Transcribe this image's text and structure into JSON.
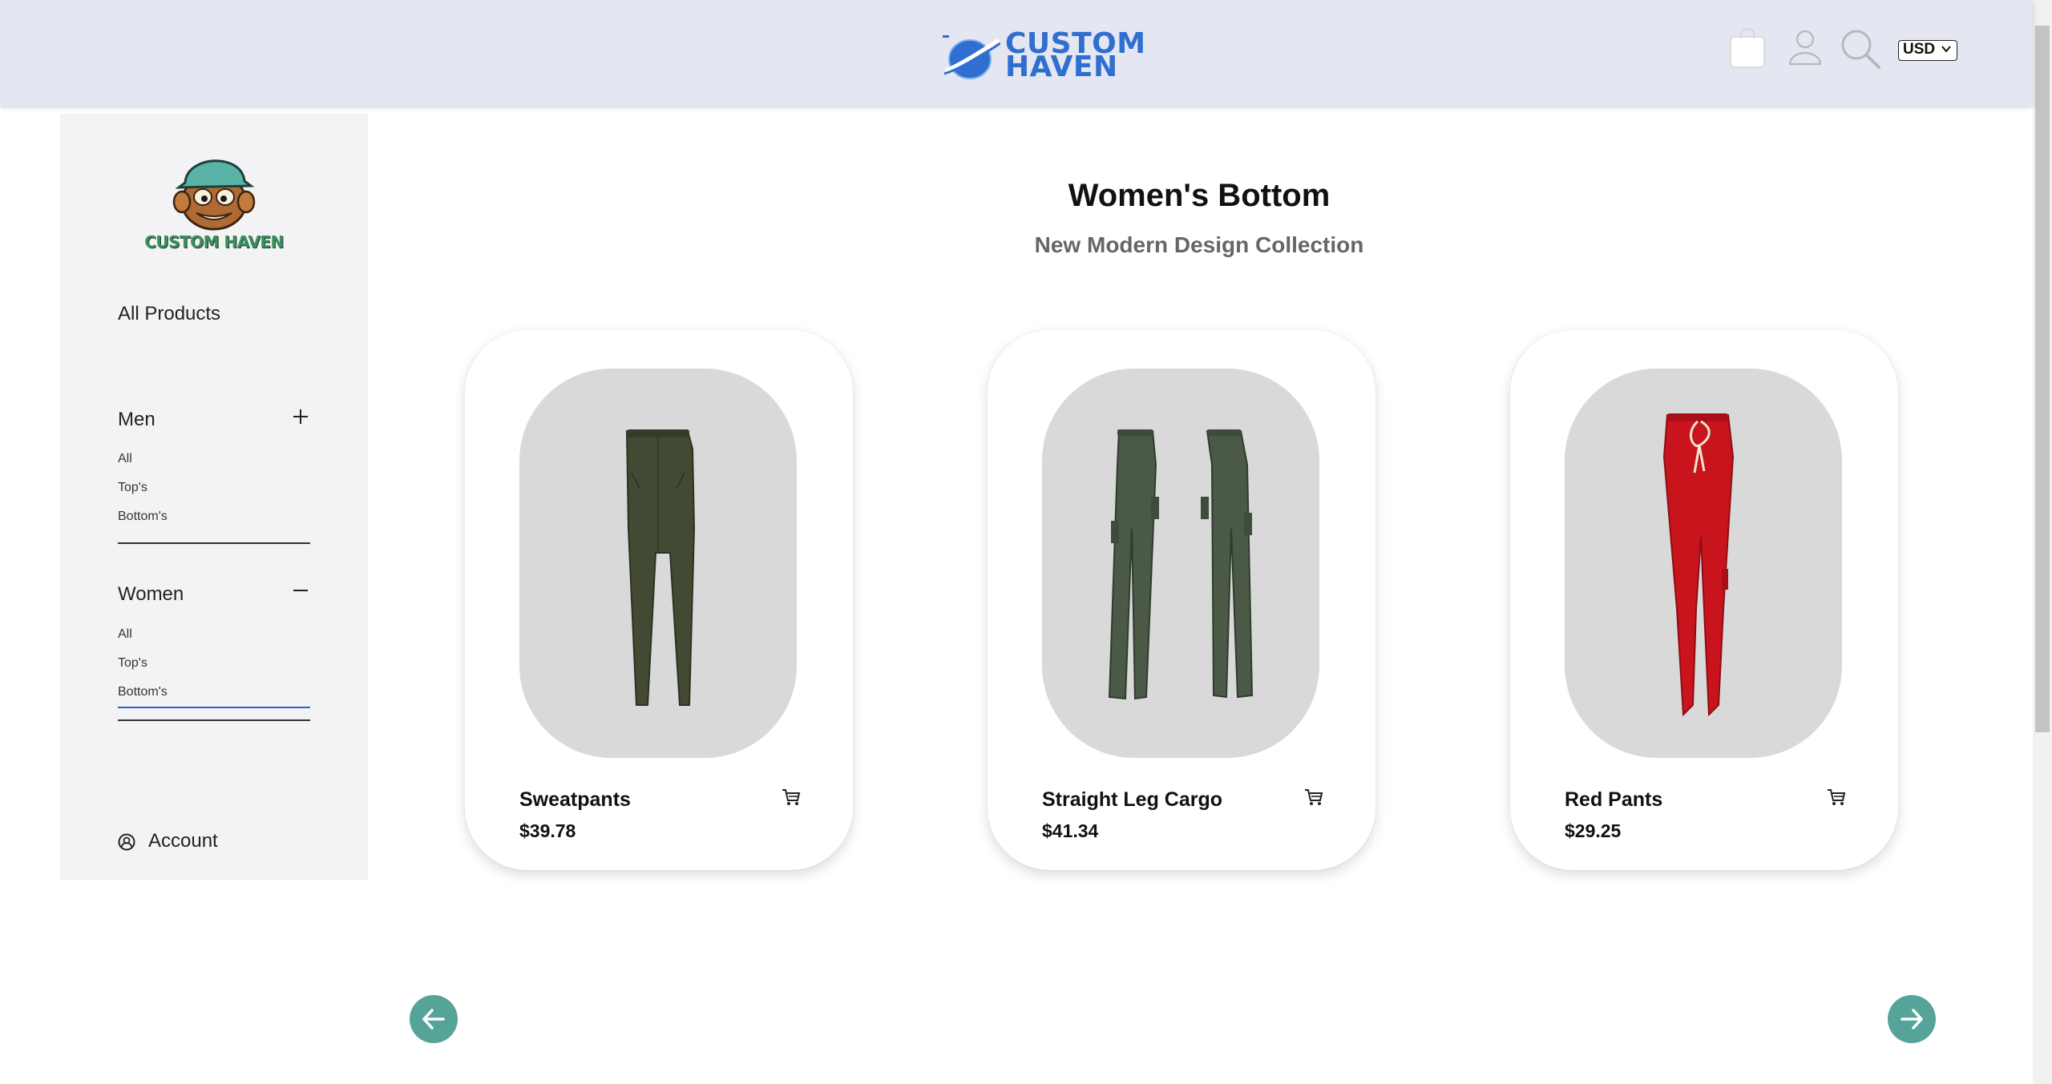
{
  "header": {
    "brand_line1": "CUSTOM",
    "brand_line2": "HAVEN",
    "currency": "USD",
    "icons": [
      "bag-icon",
      "user-icon",
      "search-icon",
      "chevron-down-icon"
    ]
  },
  "sidebar": {
    "logo_text": "CUSTOM HAVEN",
    "all_products": "All Products",
    "men": {
      "label": "Men",
      "toggle": "plus-icon",
      "items": [
        "All",
        "Top's",
        "Bottom's"
      ]
    },
    "women": {
      "label": "Women",
      "toggle": "minus-icon",
      "items": [
        "All",
        "Top's",
        "Bottom's"
      ],
      "active": "Bottom's"
    },
    "account": "Account"
  },
  "main": {
    "title": "Women's Bottom",
    "subtitle": "New Modern Design Collection"
  },
  "products": [
    {
      "name": "Sweatpants",
      "price": "$39.78",
      "color": "#434a33"
    },
    {
      "name": "Straight Leg Cargo",
      "price": "$41.34",
      "color": "#4a5a47"
    },
    {
      "name": "Red Pants",
      "price": "$29.25",
      "color": "#c9141e"
    }
  ],
  "colors": {
    "header_bg": "#e4e6f2",
    "brand_blue": "#2f6fd0",
    "nav_button": "#56a39a",
    "active_underline": "#2a64c6"
  }
}
